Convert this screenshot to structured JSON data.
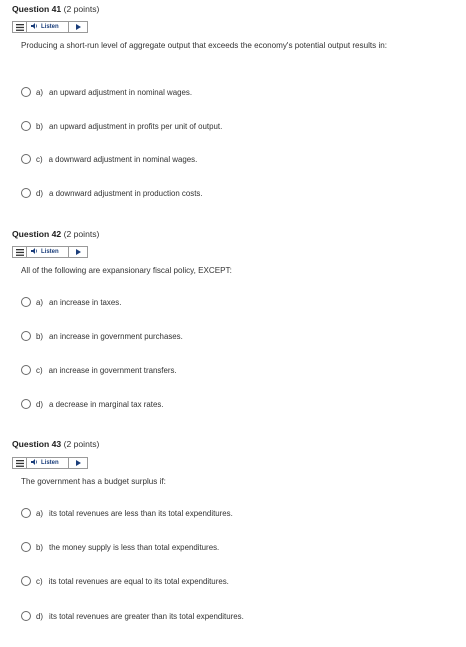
{
  "listen_label": "Listen",
  "questions": [
    {
      "title": "Question 41",
      "points": "(2 points)",
      "prompt": "Producing a short-run level of aggregate output that exceeds the economy's potential output results in:",
      "options": [
        {
          "letter": "a)",
          "text": "an upward adjustment in nominal wages."
        },
        {
          "letter": "b)",
          "text": "an upward adjustment in profits per unit of output."
        },
        {
          "letter": "c)",
          "text": "a downward adjustment in nominal wages."
        },
        {
          "letter": "d)",
          "text": "a downward adjustment in production costs."
        }
      ]
    },
    {
      "title": "Question 42",
      "points": "(2 points)",
      "prompt": "All of the following are expansionary fiscal policy, EXCEPT:",
      "options": [
        {
          "letter": "a)",
          "text": "an increase in taxes."
        },
        {
          "letter": "b)",
          "text": "an increase in government purchases."
        },
        {
          "letter": "c)",
          "text": "an increase in government transfers."
        },
        {
          "letter": "d)",
          "text": "a decrease in marginal tax rates."
        }
      ]
    },
    {
      "title": "Question 43",
      "points": "(2 points)",
      "prompt": "The government has a budget surplus if:",
      "options": [
        {
          "letter": "a)",
          "text": "its total revenues are less than its total expenditures."
        },
        {
          "letter": "b)",
          "text": "the money supply is less than total expenditures."
        },
        {
          "letter": "c)",
          "text": "its total revenues are equal to its total expenditures."
        },
        {
          "letter": "d)",
          "text": "its total revenues are greater than its total expenditures."
        }
      ]
    }
  ],
  "icons": {
    "menu": "menu-icon",
    "speaker": "speaker-icon",
    "play": "play-icon"
  },
  "colors": {
    "listen_text": "#1a3d7a",
    "radio_border": "#6a6a6a"
  }
}
